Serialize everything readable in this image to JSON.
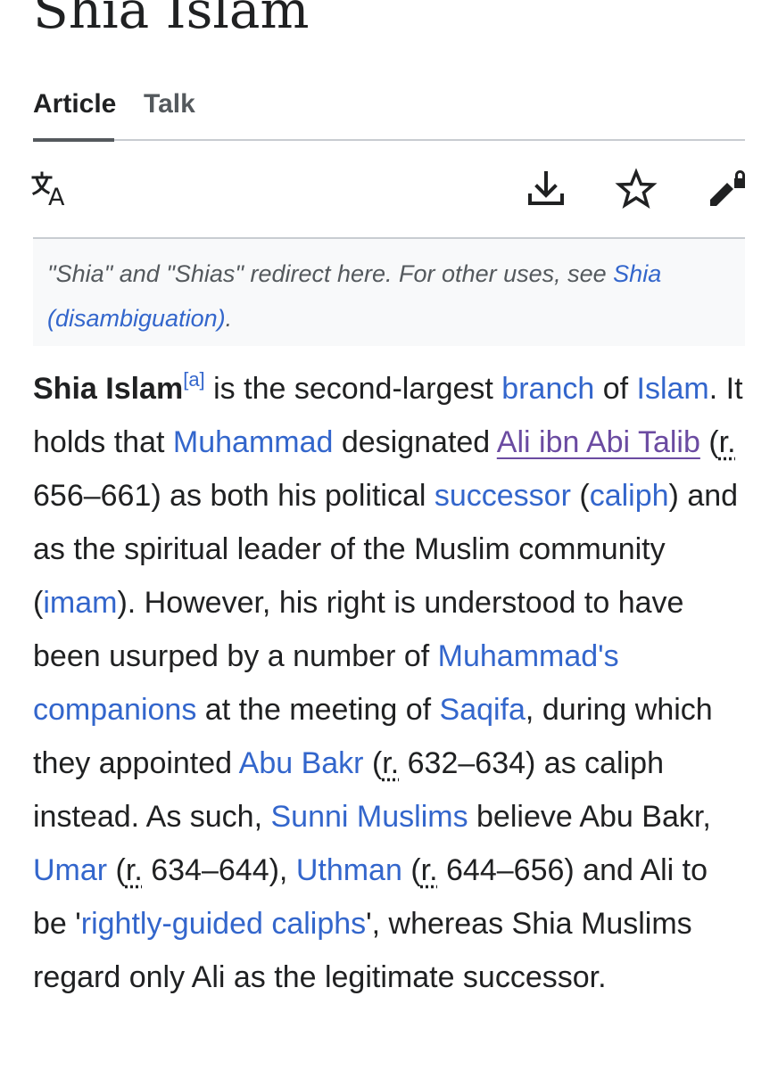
{
  "page": {
    "title": "Shia Islam"
  },
  "tabs": [
    {
      "label": "Article",
      "active": true
    },
    {
      "label": "Talk",
      "active": false
    }
  ],
  "toolbar": {
    "icons": [
      "language-icon",
      "download-icon",
      "star-icon",
      "edit-locked-icon"
    ]
  },
  "hatnote": {
    "text": "\"Shia\" and \"Shias\" redirect here. For other uses, see ",
    "link_label": "Shia (disambiguation)",
    "end": "."
  },
  "lead": {
    "segments": [
      {
        "bold": "Shia Islam"
      },
      {
        "ref": "[a]"
      },
      {
        "text": " is the second-largest "
      },
      {
        "link": "branch"
      },
      {
        "text": " of "
      },
      {
        "link": "Islam"
      },
      {
        "text": ". It holds that "
      },
      {
        "link": "Muhammad"
      },
      {
        "text": " designated "
      },
      {
        "link": "Ali ibn Abi Talib",
        "visited": true
      },
      {
        "text": " ("
      },
      {
        "abbr": "r."
      },
      {
        "text": " 656–661) as both his political "
      },
      {
        "link": "successor"
      },
      {
        "text": " ("
      },
      {
        "link": "caliph"
      },
      {
        "text": ") and as the spiritual leader of the Muslim community ("
      },
      {
        "link": "imam"
      },
      {
        "text": "). However, his right is understood to have been usurped by a number of "
      },
      {
        "link": "Muhammad's companions"
      },
      {
        "text": " at the meeting of "
      },
      {
        "link": "Saqifa"
      },
      {
        "text": ", during which they appointed "
      },
      {
        "link": "Abu Bakr"
      },
      {
        "text": " ("
      },
      {
        "abbr": "r."
      },
      {
        "text": " 632–634) as caliph instead. As such, "
      },
      {
        "link": "Sunni Muslims"
      },
      {
        "text": " believe Abu Bakr, "
      },
      {
        "link": "Umar"
      },
      {
        "text": " ("
      },
      {
        "abbr": "r."
      },
      {
        "text": " 634–644), "
      },
      {
        "link": "Uthman"
      },
      {
        "text": " ("
      },
      {
        "abbr": "r."
      },
      {
        "text": " 644–656) and Ali to be '"
      },
      {
        "link": "rightly-guided caliphs"
      },
      {
        "text": "', whereas Shia Muslims regard only Ali as the legitimate successor."
      }
    ]
  },
  "colors": {
    "link": "#3366cc",
    "visited_link": "#6b4ba1",
    "text": "#202122",
    "muted": "#54595d",
    "hatnote_bg": "#f8f9fa",
    "divider": "#c8ccd1"
  }
}
